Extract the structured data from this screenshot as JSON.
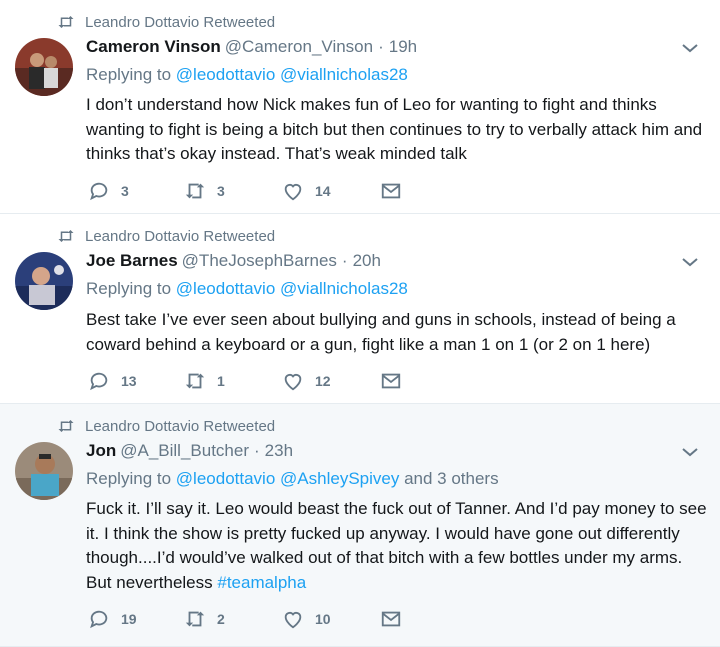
{
  "tweets": [
    {
      "retweeted_by": "Leandro Dottavio Retweeted",
      "name": "Cameron Vinson",
      "handle": "@Cameron_Vinson",
      "time": "19h",
      "replying_label": "Replying to",
      "mentions": [
        "@leodottavio",
        "@viallnicholas28"
      ],
      "others": "",
      "text": "I don’t understand how Nick makes fun of Leo for wanting to fight  and thinks wanting to fight is being a bitch but then continues to try to verbally attack him and thinks that’s okay instead. That’s weak minded talk",
      "replies": "3",
      "retweets": "3",
      "likes": "14"
    },
    {
      "retweeted_by": "Leandro Dottavio Retweeted",
      "name": "Joe Barnes",
      "handle": "@TheJosephBarnes",
      "time": "20h",
      "replying_label": "Replying to",
      "mentions": [
        "@leodottavio",
        "@viallnicholas28"
      ],
      "others": "",
      "text": "Best take I’ve ever seen about bullying and guns in schools, instead of being a coward behind a keyboard or a gun, fight like a man 1 on 1 (or 2 on 1 here)",
      "replies": "13",
      "retweets": "1",
      "likes": "12"
    },
    {
      "retweeted_by": "Leandro Dottavio Retweeted",
      "name": "Jon",
      "handle": "@A_Bill_Butcher",
      "time": "23h",
      "replying_label": "Replying to",
      "mentions": [
        "@leodottavio",
        "@AshleySpivey"
      ],
      "others": "and 3 others",
      "text": "Fuck it. I’ll say it. Leo would beast the fuck out of Tanner. And I’d pay money to see it. I think the show is pretty fucked up anyway. I would have gone out differently though....I’d would’ve walked out of that bitch with a few bottles under my arms. But nevertheless ",
      "hashtag": "#teamalpha",
      "replies": "19",
      "retweets": "2",
      "likes": "10"
    }
  ],
  "icons": {
    "retweet": "retweet-icon",
    "reply": "reply-icon",
    "like": "heart-icon",
    "dm": "envelope-icon",
    "caret": "chevron-down-icon"
  },
  "colors": {
    "link": "#1da1f2",
    "muted": "#657786",
    "text": "#14171a",
    "divider": "#e6ecf0",
    "highlight_bg": "#f5f8fa"
  }
}
